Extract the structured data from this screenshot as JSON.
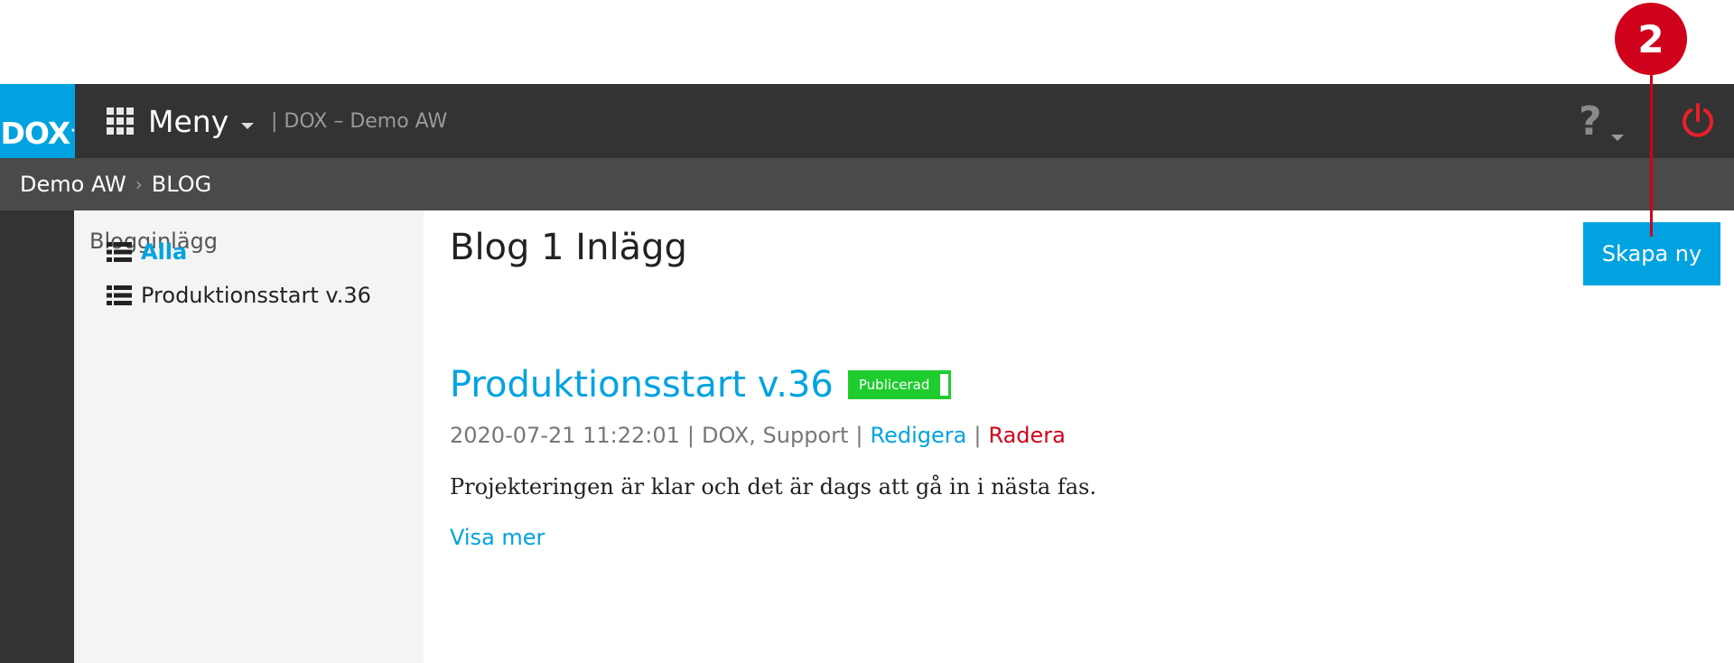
{
  "callout": {
    "number": "2",
    "color": "#d0021b"
  },
  "header": {
    "logo_text": "DOX",
    "logo_dot": "·",
    "menu_label": "Meny",
    "site_name": "| DOX – Demo AW",
    "help_label": "?",
    "icons": {
      "menu": "grid-icon",
      "help": "question-icon",
      "power": "power-icon"
    },
    "colors": {
      "header_bg": "#333333",
      "logo_bg": "#00a3e0",
      "power": "#e8202a"
    }
  },
  "breadcrumb": {
    "items": [
      "Demo AW",
      "BLOG"
    ],
    "separator": "›"
  },
  "sidebar": {
    "heading": "Blogginlägg",
    "items": [
      {
        "label": "Alla",
        "active": true
      },
      {
        "label": "Produktionsstart v.36",
        "active": false
      }
    ]
  },
  "main": {
    "title": "Blog 1 Inlägg",
    "create_button": "Skapa ny",
    "post": {
      "title": "Produktionsstart v.36",
      "status": "Publicerad",
      "date": "2020-07-21 11:22:01",
      "authors": "DOX, Support",
      "edit_label": "Redigera",
      "delete_label": "Radera",
      "meta_separator": "|",
      "excerpt": "Projekteringen är klar och det är dags att gå in i nästa fas.",
      "read_more": "Visa mer"
    },
    "colors": {
      "accent": "#00a3e0",
      "published": "#1ecc2e",
      "danger": "#d0021b"
    }
  }
}
